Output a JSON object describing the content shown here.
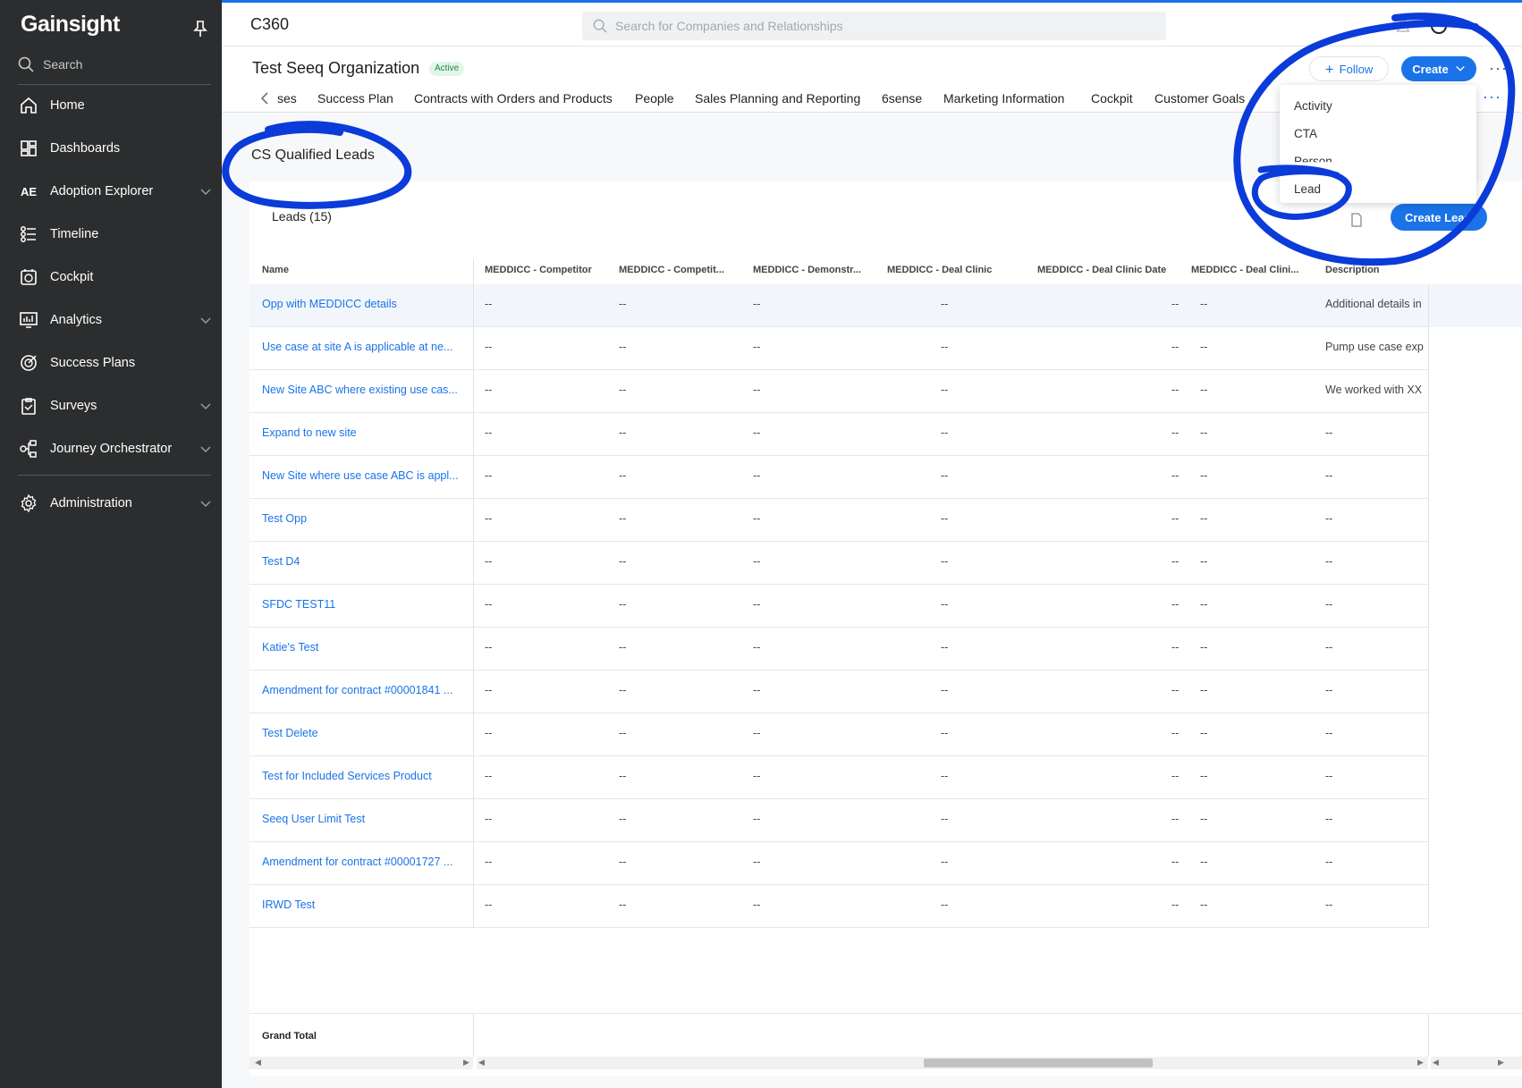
{
  "sidebar": {
    "brand": "Gainsight",
    "search_label": "Search",
    "items": [
      {
        "label": "Home"
      },
      {
        "label": "Dashboards"
      },
      {
        "label": "Adoption Explorer",
        "tag": "AE"
      },
      {
        "label": "Timeline"
      },
      {
        "label": "Cockpit"
      },
      {
        "label": "Analytics"
      },
      {
        "label": "Success Plans"
      },
      {
        "label": "Surveys"
      },
      {
        "label": "Journey Orchestrator"
      },
      {
        "label": "Administration"
      }
    ]
  },
  "topbar": {
    "title": "C360",
    "search_placeholder": "Search for Companies and Relationships"
  },
  "header": {
    "org_name": "Test Seeq Organization",
    "status": "Active",
    "follow_label": "Follow",
    "create_label": "Create",
    "more": "···"
  },
  "tabs": [
    "ses",
    "Success Plan",
    "Contracts with Orders and Products",
    "People",
    "Sales Planning and Reporting",
    "6sense",
    "Marketing Information",
    "Cockpit",
    "Customer Goals"
  ],
  "tabs_more": "···",
  "create_menu": [
    "Activity",
    "CTA",
    "Person",
    "Lead"
  ],
  "section": {
    "title": "CS Qualified Leads",
    "card_title": "Leads (15)",
    "create_lead_label": "Create Lead"
  },
  "table": {
    "columns": [
      "Name",
      "MEDDICC - Competitor",
      "MEDDICC - Competit...",
      "MEDDICC - Demonstr...",
      "MEDDICC - Deal Clinic",
      "MEDDICC - Deal Clinic Date",
      "MEDDICC - Deal Clini...",
      "Description"
    ],
    "rows": [
      {
        "name": "Opp with MEDDICC details",
        "description": "Additional details in"
      },
      {
        "name": "Use case at site A is applicable at ne...",
        "description": "Pump use case exp"
      },
      {
        "name": "New Site ABC where existing use cas...",
        "description": "We worked with XX"
      },
      {
        "name": "Expand to new site",
        "description": "--"
      },
      {
        "name": "New Site where use case ABC is appl...",
        "description": "--"
      },
      {
        "name": "Test Opp",
        "description": "--"
      },
      {
        "name": "Test D4",
        "description": "--"
      },
      {
        "name": "SFDC TEST11",
        "description": "--"
      },
      {
        "name": "Katie's Test",
        "description": "--"
      },
      {
        "name": "Amendment for contract #00001841 ...",
        "description": "--"
      },
      {
        "name": "Test Delete",
        "description": "--"
      },
      {
        "name": "Test for Included Services Product",
        "description": "--"
      },
      {
        "name": "Seeq User Limit Test",
        "description": "--"
      },
      {
        "name": "Amendment for contract #00001727 ...",
        "description": "--"
      },
      {
        "name": "IRWD Test",
        "description": "--"
      }
    ],
    "empty_value": "--",
    "grand_total_label": "Grand Total"
  },
  "colors": {
    "accent": "#1a73e8",
    "sidebar_bg": "#2c2d2e",
    "annotation": "#0b3bd9"
  }
}
